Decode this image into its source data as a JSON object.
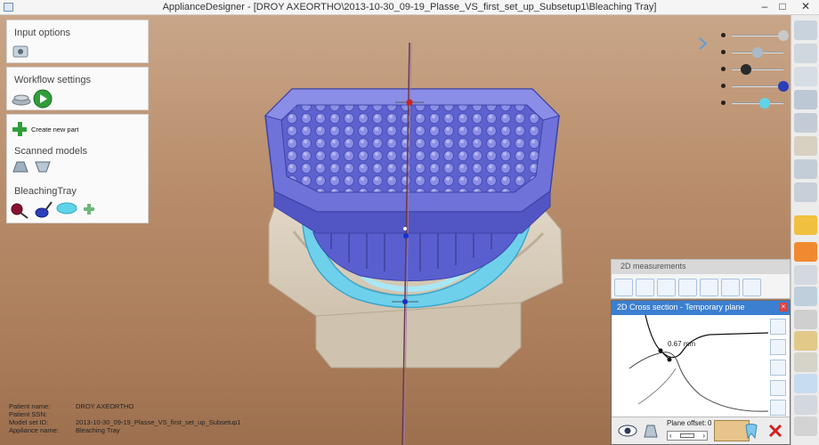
{
  "window": {
    "title": "ApplianceDesigner - [DROY AXEORTHO\\2013-10-30_09-19_Plasse_VS_first_set_up_Subsetup1\\Bleaching Tray]",
    "minimize": "–",
    "maximize": "□",
    "close": "✕"
  },
  "panels": {
    "input_options": {
      "title": "Input options"
    },
    "workflow_settings": {
      "title": "Workflow settings"
    },
    "parts": {
      "create_new_part": "Create new part",
      "scanned_models": "Scanned models",
      "bleaching_tray": "BleachingTray"
    }
  },
  "patient_info": [
    {
      "label": "Patient name:",
      "value": "DROY AXEORTHO"
    },
    {
      "label": "Patient SSN:",
      "value": ""
    },
    {
      "label": "Model set ID:",
      "value": "2013-10-30_09-19_Plasse_VS_first_set_up_Subsetup1"
    },
    {
      "label": "Appliance name:",
      "value": "Bleaching Tray"
    }
  ],
  "visibility_sliders": [
    {
      "name": "model-upper",
      "level": 1.0,
      "color": "#c9c9c9"
    },
    {
      "name": "model-lower",
      "level": 0.45,
      "color": "#a9b9c8"
    },
    {
      "name": "dark-part",
      "level": 0.2,
      "color": "#2a2a2a"
    },
    {
      "name": "blue-part",
      "level": 1.0,
      "color": "#2a3fb8"
    },
    {
      "name": "tray",
      "level": 0.6,
      "color": "#5fd4e8"
    }
  ],
  "measurements_panel": {
    "title": "2D measurements"
  },
  "cross_section": {
    "title": "2D Cross section - Temporary plane",
    "measure_label": "0.67 mm",
    "plane_offset_label": "Plane offset:",
    "plane_offset_value": "0"
  },
  "colors": {
    "tray_blue": "#6f72d8",
    "gum_cyan": "#6fd0ec",
    "model_beige": "#d8cdbc",
    "header_blue": "#3b7fd0"
  }
}
